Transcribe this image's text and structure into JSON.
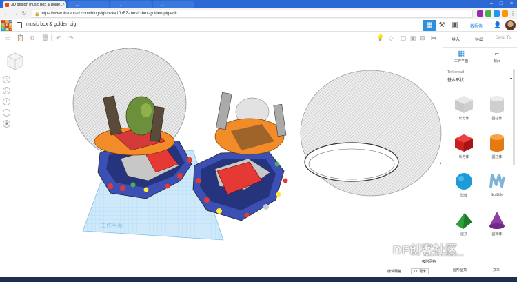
{
  "browser": {
    "active_tab_title": "3D design music box & golde...",
    "inactive_tab_1": "...",
    "inactive_tab_2": "...",
    "inactive_tab_3": "...",
    "url": "https://www.tinkercad.com/things/gkmzka1JpEZ-music-box-golden-pig/edit"
  },
  "app": {
    "logo_letters": [
      "T",
      "I",
      "N",
      "K",
      "E",
      "R",
      "C",
      "A",
      "D"
    ],
    "logo_colors": [
      "#e23b2e",
      "#f2a33a",
      "#2d8fdc",
      "#7bbf3b",
      "#e23b2e",
      "#f2a33a",
      "#2d8fdc",
      "#7bbf3b",
      "#e23b2e"
    ],
    "project_title": "music box & golden pig",
    "header_link": "教程侍",
    "accent": "#2d8fdc"
  },
  "right_panel": {
    "import_label": "导入",
    "export_label": "导出",
    "send_to_label": "Send To",
    "workplane_label": "工作平面",
    "ruler_label": "标尺",
    "library_source": "Tinkercad",
    "library_selected": "基本形状",
    "shapes": [
      {
        "label": "长方体",
        "icon": "box-hole-icon"
      },
      {
        "label": "圆柱体",
        "icon": "cylinder-hole-icon"
      },
      {
        "label": "长方体",
        "icon": "box-icon"
      },
      {
        "label": "圆柱体",
        "icon": "cylinder-icon"
      },
      {
        "label": "球体",
        "icon": "sphere-icon"
      },
      {
        "label": "Scribble",
        "icon": "scribble-icon"
      },
      {
        "label": "屋顶",
        "icon": "roof-icon"
      },
      {
        "label": "圆锥体",
        "icon": "cone-icon"
      }
    ],
    "partial_labels": [
      "圆形屋顶",
      "文本"
    ]
  },
  "bottom": {
    "snap_label": "编辑网格",
    "snap_grid_label": "吸附网格",
    "snap_value": "1.0 毫米"
  },
  "workspace": {
    "workplane_text": "工作平面"
  },
  "watermark": {
    "main": "DF创客社区",
    "sub": "mc.DFRobot.com.cn"
  }
}
